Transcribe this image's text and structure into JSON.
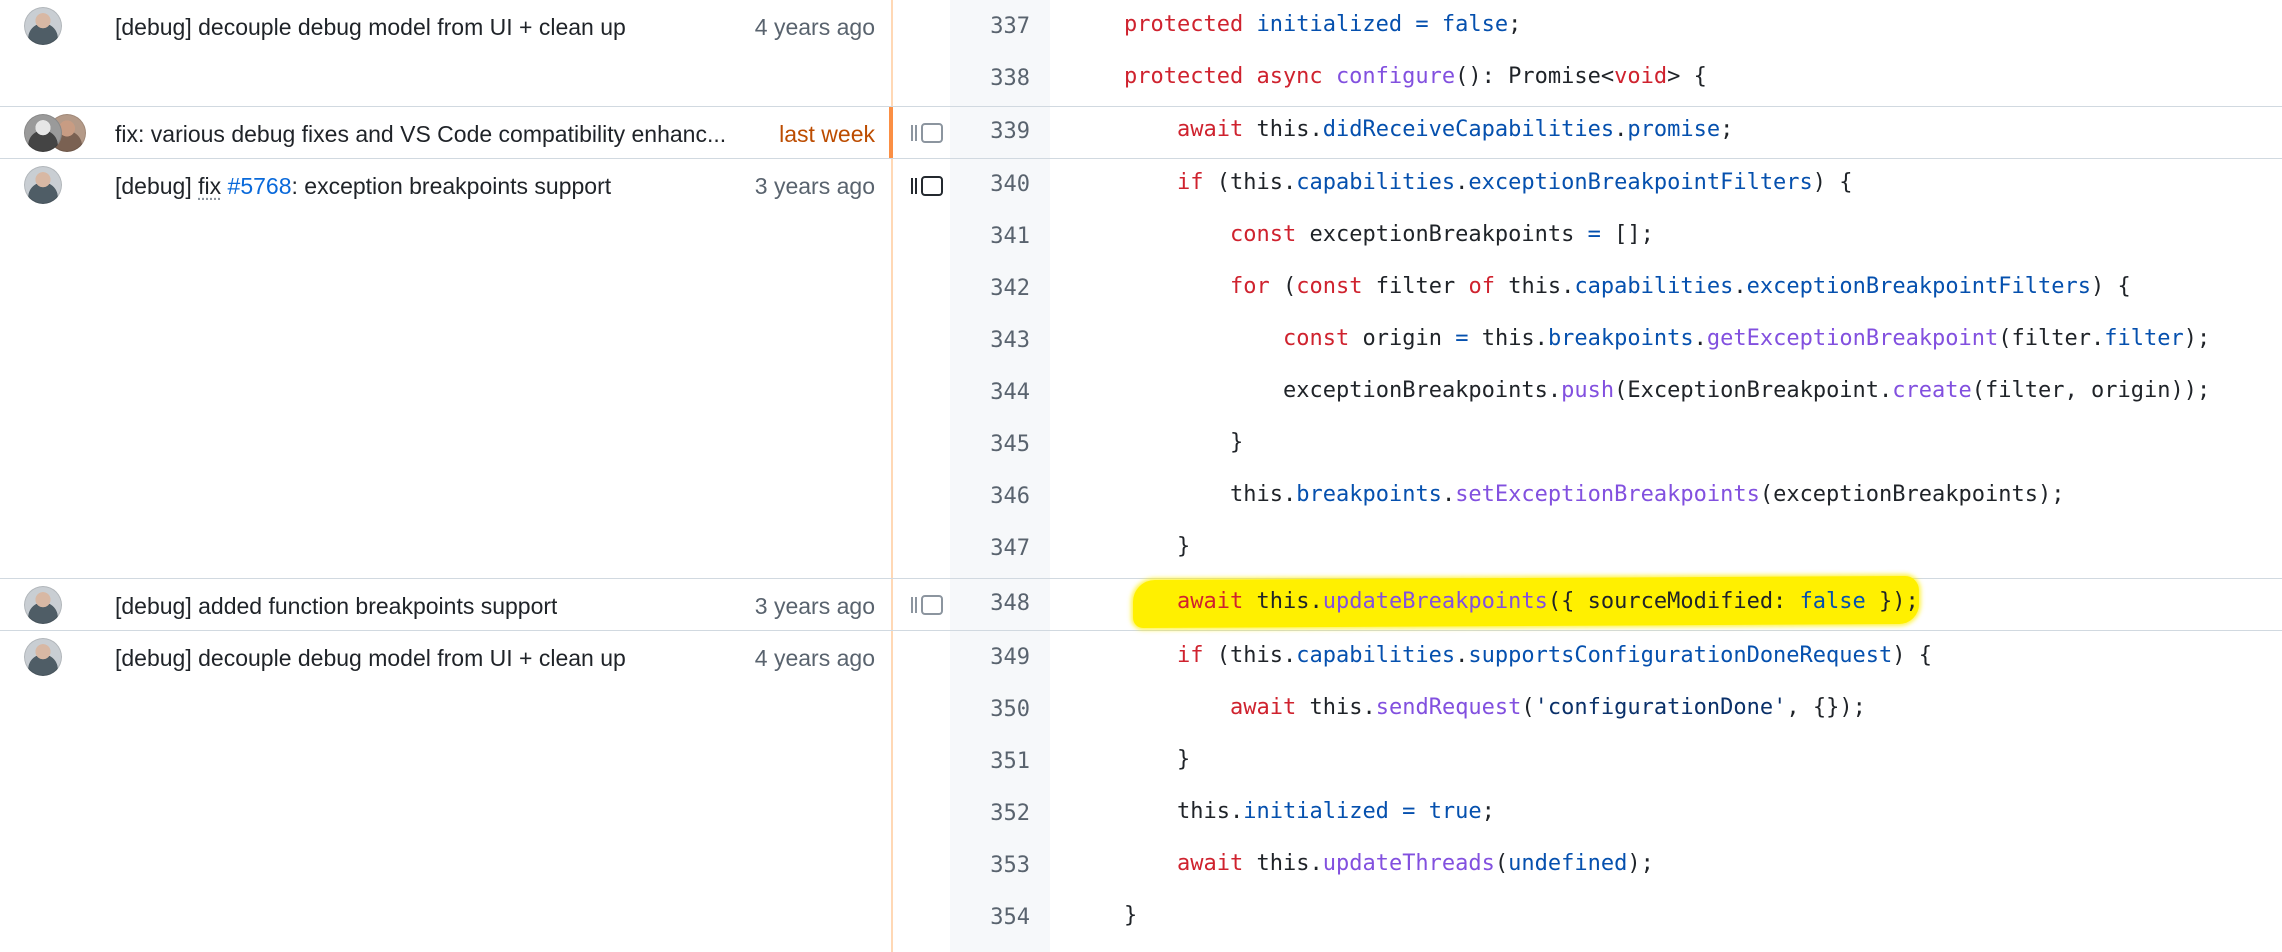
{
  "commits": [
    {
      "message": "[debug] decouple debug model from UI + clean up",
      "date": "4 years ago"
    },
    {
      "message": "fix: various debug fixes and VS Code compatibility enhanc...",
      "date": "last week"
    },
    {
      "message_prefix": "[debug] ",
      "message_under": "fix",
      "issue": "#5768",
      "message_suffix": ": exception breakpoints support",
      "date": "3 years ago"
    },
    {
      "message": "[debug] added function breakpoints support",
      "date": "3 years ago"
    },
    {
      "message": "[debug] decouple debug model from UI + clean up",
      "date": "4 years ago"
    }
  ],
  "lines": [
    {
      "num": "337"
    },
    {
      "num": "338"
    },
    {
      "num": "339"
    },
    {
      "num": "340"
    },
    {
      "num": "341"
    },
    {
      "num": "342"
    },
    {
      "num": "343"
    },
    {
      "num": "344"
    },
    {
      "num": "345"
    },
    {
      "num": "346"
    },
    {
      "num": "347"
    },
    {
      "num": "348"
    },
    {
      "num": "349"
    },
    {
      "num": "350"
    },
    {
      "num": "351"
    },
    {
      "num": "352"
    },
    {
      "num": "353"
    },
    {
      "num": "354"
    }
  ],
  "code": {
    "l337": {
      "kw1": "protected",
      "p1": "initialized",
      "op": " = ",
      "kw2": "false",
      "end": ";"
    },
    "l338": {
      "kw1": "protected async",
      "fn": "configure",
      "rest": "(): Promise<",
      "kw2": "void",
      "end": "> {"
    },
    "l339": {
      "kw": "await",
      "t1": " this.",
      "p1": "didReceiveCapabilities",
      "t2": ".",
      "p2": "promise",
      "end": ";"
    },
    "l340": {
      "kw": "if",
      "t1": " (this.",
      "p1": "capabilities",
      "t2": ".",
      "p2": "exceptionBreakpointFilters",
      "end": ") {"
    },
    "l341": {
      "kw": "const",
      "t1": " exceptionBreakpoints ",
      "p1": "=",
      "end": " [];"
    },
    "l342": {
      "kw1": "for",
      "t1": " (",
      "kw2": "const",
      "t2": " filter ",
      "kw3": "of",
      "t3": " this.",
      "p1": "capabilities",
      "t4": ".",
      "p2": "exceptionBreakpointFilters",
      "end": ") {"
    },
    "l343": {
      "kw": "const",
      "t1": " origin ",
      "p0": "=",
      "t2": " this.",
      "p1": "breakpoints",
      "t3": ".",
      "fn": "getExceptionBreakpoint",
      "t4": "(filter.",
      "p2": "filter",
      "end": ");"
    },
    "l344": {
      "t1": "exceptionBreakpoints.",
      "fn1": "push",
      "t2": "(ExceptionBreakpoint.",
      "fn2": "create",
      "end": "(filter, origin));"
    },
    "l345": {
      "end": "}"
    },
    "l346": {
      "t1": "this.",
      "p1": "breakpoints",
      "t2": ".",
      "fn": "setExceptionBreakpoints",
      "end": "(exceptionBreakpoints);"
    },
    "l347": {
      "end": "}"
    },
    "l348": {
      "kw": "await",
      "t1": " this.",
      "fn": "updateBreakpoints",
      "t2": "({ sourceModified: ",
      "kw2": "false",
      "end": " });"
    },
    "l349": {
      "kw": "if",
      "t1": " (this.",
      "p1": "capabilities",
      "t2": ".",
      "p2": "supportsConfigurationDoneRequest",
      "end": ") {"
    },
    "l350": {
      "kw": "await",
      "t1": " this.",
      "fn": "sendRequest",
      "t2": "(",
      "str": "'configurationDone'",
      "end": ", {});"
    },
    "l351": {
      "end": "}"
    },
    "l352": {
      "t1": "this.",
      "p1": "initialized",
      "op": " = ",
      "kw": "true",
      "end": ";"
    },
    "l353": {
      "kw": "await",
      "t1": " this.",
      "fn": "updateThreads",
      "t2": "(",
      "p1": "undefined",
      "end": ");"
    },
    "l354": {
      "end": "}"
    }
  },
  "colors": {
    "highlight": "#fff000",
    "recent_marker": "#fb8f44",
    "keyword": "#cf222e",
    "property": "#0550ae",
    "function": "#8250df"
  },
  "icons": [
    "avatar",
    "reblame-icon"
  ]
}
